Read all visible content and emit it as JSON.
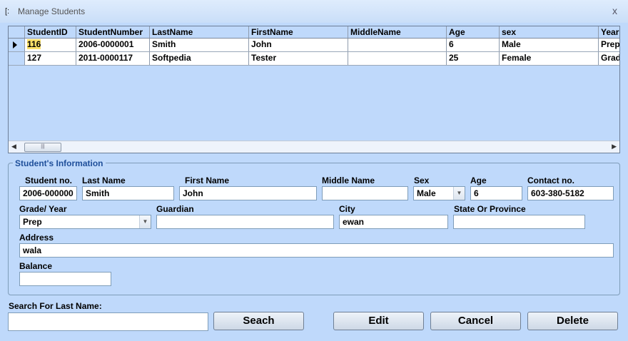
{
  "window": {
    "title": "Manage Students",
    "icon": "window-app-icon",
    "close_glyph": "x"
  },
  "grid": {
    "columns": [
      "StudentID",
      "StudentNumber",
      "LastName",
      "FirstName",
      "MiddleName",
      "Age",
      "sex",
      "Year"
    ],
    "rows": [
      {
        "cells": [
          "116",
          "2006-0000001",
          "Smith",
          "John",
          "",
          "6",
          "Male",
          "Prep"
        ]
      },
      {
        "cells": [
          "127",
          "2011-0000117",
          "Softpedia",
          "Tester",
          "",
          "25",
          "Female",
          "Grad"
        ]
      }
    ]
  },
  "info": {
    "title": "Student's Information",
    "labels": {
      "student_no": "Student no.",
      "last_name": "Last Name",
      "first_name": "First Name",
      "middle_name": "Middle Name",
      "sex": "Sex",
      "age": "Age",
      "contact": "Contact no.",
      "grade": "Grade/ Year",
      "guardian": "Guardian",
      "city": "City",
      "state": "State Or Province",
      "address": "Address",
      "balance": "Balance"
    },
    "values": {
      "student_no": "2006-000000",
      "last_name": "Smith",
      "first_name": "John",
      "middle_name": "",
      "sex": "Male",
      "age": "6",
      "contact": "603-380-5182",
      "grade": "Prep",
      "guardian": "",
      "city": "ewan",
      "state": "",
      "address": "wala",
      "balance": ""
    }
  },
  "search": {
    "label": "Search For Last Name:",
    "value": "",
    "button": "Seach"
  },
  "actions": {
    "edit": "Edit",
    "cancel": "Cancel",
    "delete": "Delete"
  },
  "colors": {
    "background": "#bfd9fb",
    "group_title": "#1f4f9a",
    "selection": "#fbe16a"
  }
}
